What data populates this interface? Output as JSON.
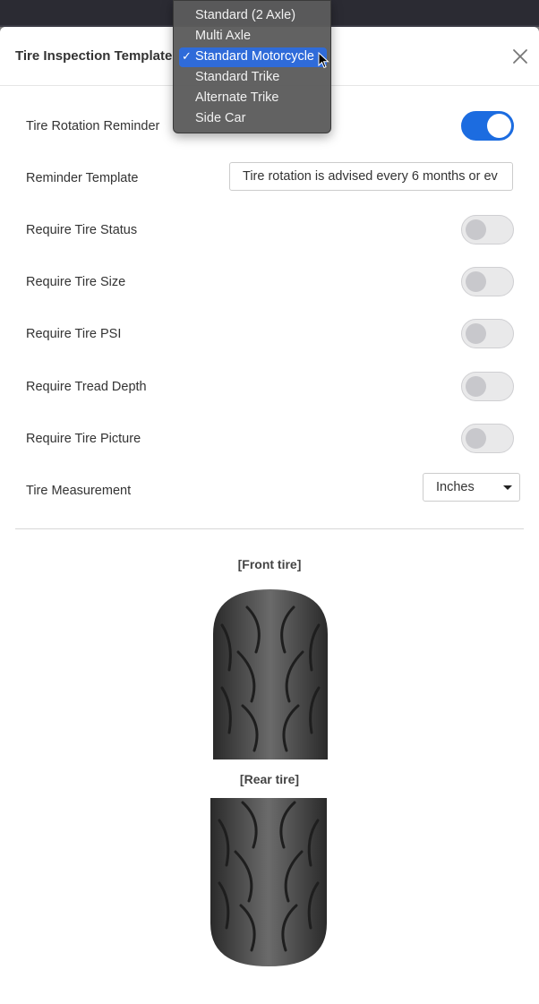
{
  "modal": {
    "title": "Tire Inspection Template",
    "close_icon": "close-icon"
  },
  "settings": {
    "rotation_reminder": {
      "label": "Tire Rotation Reminder",
      "on": true
    },
    "reminder_template": {
      "label": "Reminder Template",
      "value": "Tire rotation is advised every 6 months or ev"
    },
    "require_status": {
      "label": "Require Tire Status",
      "on": false
    },
    "require_size": {
      "label": "Require Tire Size",
      "on": false
    },
    "require_psi": {
      "label": "Require Tire PSI",
      "on": false
    },
    "require_tread": {
      "label": "Require Tread Depth",
      "on": false
    },
    "require_picture": {
      "label": "Require Tire Picture",
      "on": false
    },
    "measurement": {
      "label": "Tire Measurement",
      "value": "Inches"
    }
  },
  "tires": {
    "front_label": "[Front tire]",
    "rear_label": "[Rear tire]"
  },
  "dropdown": {
    "options": [
      "Standard (2 Axle)",
      "Multi Axle",
      "Standard Motorcycle",
      "Standard Trike",
      "Alternate Trike",
      "Side Car"
    ],
    "selected": "Standard Motorcycle",
    "check_icon": "checkmark-icon"
  },
  "colors": {
    "accent": "#1c6ce0",
    "popup_selection": "#2f6bd9"
  }
}
